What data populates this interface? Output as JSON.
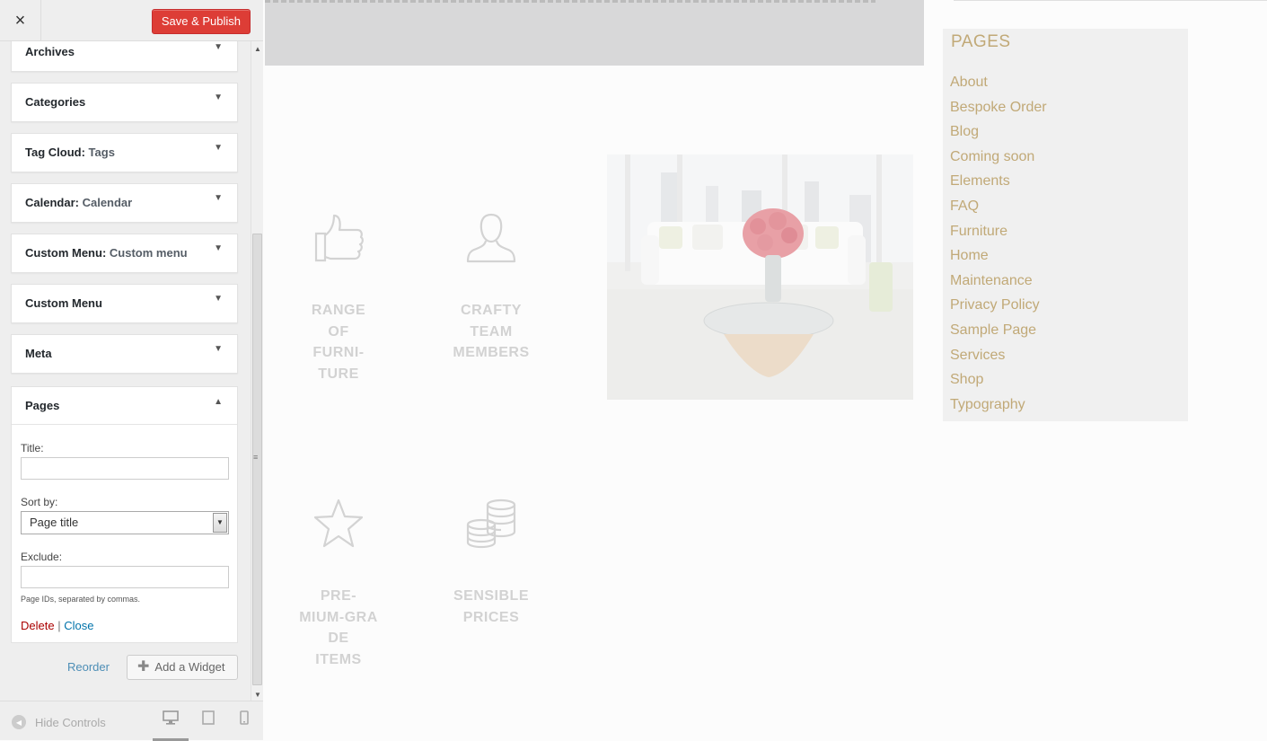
{
  "customizer": {
    "close_glyph": "×",
    "save_label": "Save & Publish",
    "widgets": [
      {
        "title": "Archives",
        "subtitle": ""
      },
      {
        "title": "Categories",
        "subtitle": ""
      },
      {
        "title": "Tag Cloud:",
        "subtitle": "Tags"
      },
      {
        "title": "Calendar:",
        "subtitle": "Calendar"
      },
      {
        "title": "Custom Menu:",
        "subtitle": "Custom menu"
      },
      {
        "title": "Custom Menu",
        "subtitle": ""
      },
      {
        "title": "Meta",
        "subtitle": ""
      }
    ],
    "pages_widget": {
      "title": "Pages",
      "title_label": "Title:",
      "title_value": "",
      "sort_label": "Sort by:",
      "sort_value": "Page title",
      "exclude_label": "Exclude:",
      "exclude_value": "",
      "hint": "Page IDs, separated by commas.",
      "delete_label": "Delete",
      "separator": "|",
      "close_label": "Close"
    },
    "reorder_label": "Reorder",
    "add_widget_label": "Add a Widget",
    "hide_controls_label": "Hide Controls",
    "device_icons": [
      "desktop-icon",
      "tablet-icon",
      "mobile-icon"
    ]
  },
  "preview": {
    "features": [
      {
        "icon": "thumbs-up-icon",
        "lines": [
          "RANGE",
          "OF",
          "FURNI-",
          "TURE"
        ]
      },
      {
        "icon": "person-icon",
        "lines": [
          "CRAFTY",
          "TEAM",
          "MEMBERS"
        ]
      },
      {
        "icon": "star-icon",
        "lines": [
          "PRE-",
          "MIUM-GRA",
          "DE",
          "ITEMS"
        ]
      },
      {
        "icon": "coins-icon",
        "lines": [
          "SENSIBLE",
          "PRICES"
        ]
      }
    ],
    "pages_title": "PAGES",
    "pages": [
      "About",
      "Bespoke Order",
      "Blog",
      "Coming soon",
      "Elements",
      "FAQ",
      "Furniture",
      "Home",
      "Maintenance",
      "Privacy Policy",
      "Sample Page",
      "Services",
      "Shop",
      "Typography"
    ],
    "accent_color": "#c1a977",
    "save_color": "#dd3d36"
  }
}
